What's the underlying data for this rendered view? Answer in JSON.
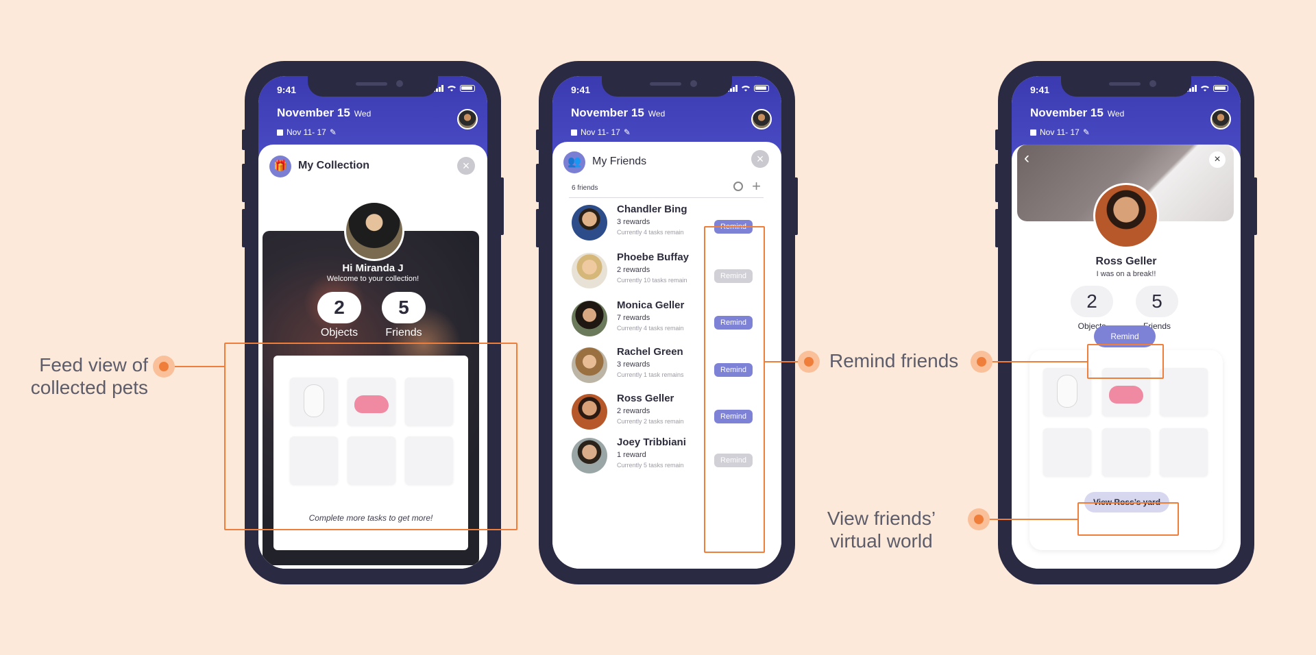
{
  "status": {
    "time": "9:41"
  },
  "header": {
    "date": "November 15",
    "day": "Wed",
    "week": "Nov 11- 17"
  },
  "collection": {
    "title": "My Collection",
    "greeting": "Hi Miranda J",
    "welcome": "Welcome to your collection!",
    "objects_count": "2",
    "objects_label": "Objects",
    "friends_count": "5",
    "friends_label": "Friends",
    "card_message": "Complete more tasks to get more!"
  },
  "friends": {
    "title": "My Friends",
    "count_text": "6 friends",
    "remind_label": "Remind",
    "list": [
      {
        "name": "Chandler Bing",
        "rewards": "3 rewards",
        "remain": "Currently 4 tasks remain",
        "enabled": true
      },
      {
        "name": "Phoebe Buffay",
        "rewards": "2 rewards",
        "remain": "Currently 10 tasks remain",
        "enabled": false
      },
      {
        "name": "Monica Geller",
        "rewards": "7 rewards",
        "remain": "Currently 4 tasks remain",
        "enabled": true
      },
      {
        "name": "Rachel Green",
        "rewards": "3 rewards",
        "remain": "Currently 1 task remains",
        "enabled": true
      },
      {
        "name": "Ross Geller",
        "rewards": "2 rewards",
        "remain": "Currently 2 tasks remain",
        "enabled": true
      },
      {
        "name": "Joey Tribbiani",
        "rewards": "1 reward",
        "remain": "Currently 5 tasks remain",
        "enabled": false
      }
    ]
  },
  "profile": {
    "name": "Ross Geller",
    "status": "I was on a break!!",
    "objects_count": "2",
    "objects_label": "Objects",
    "friends_count": "5",
    "friends_label": "Friends",
    "remind_label": "Remind",
    "view_yard_label": "View Ross’s yard"
  },
  "annotations": {
    "feed": "Feed view of collected pets",
    "remind": "Remind friends",
    "virtual": "View friends’ virtual world"
  },
  "colors": {
    "accent": "#f07e3b",
    "header": "#3b3ab0",
    "remind": "#7d82d6",
    "background": "#fde9d9"
  }
}
